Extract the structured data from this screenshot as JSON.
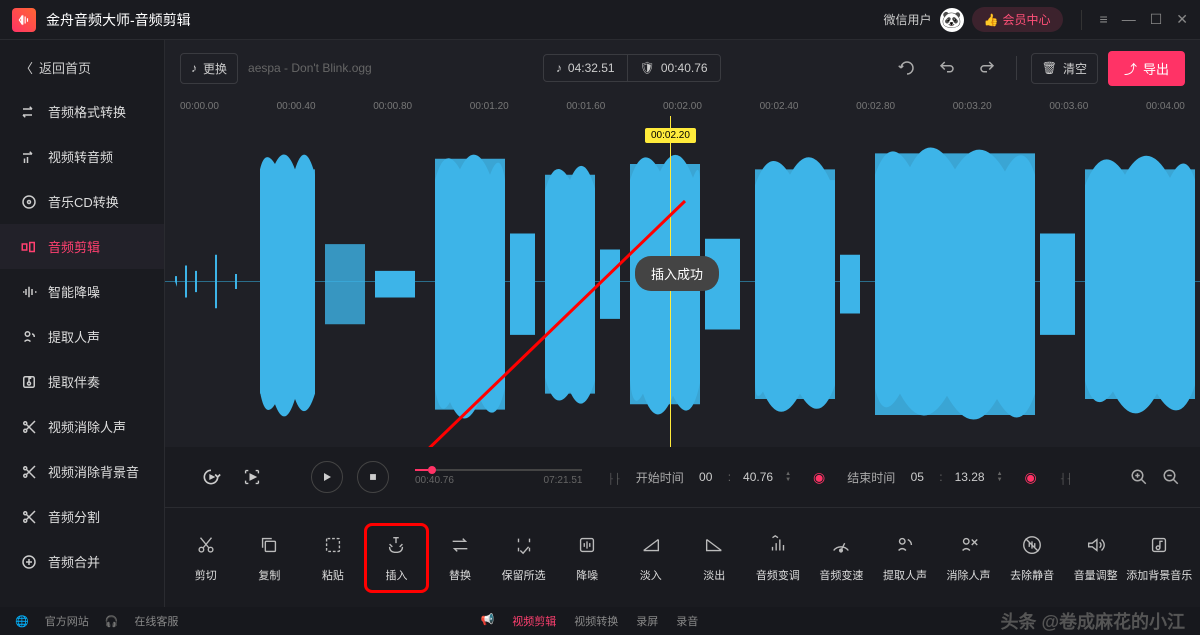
{
  "header": {
    "title": "金舟音频大师-音频剪辑",
    "user_label": "微信用户",
    "vip_label": "会员中心"
  },
  "sidebar": {
    "back": "返回首页",
    "items": [
      {
        "label": "音频格式转换"
      },
      {
        "label": "视频转音频"
      },
      {
        "label": "音乐CD转换"
      },
      {
        "label": "音频剪辑"
      },
      {
        "label": "智能降噪"
      },
      {
        "label": "提取人声"
      },
      {
        "label": "提取伴奏"
      },
      {
        "label": "视频消除人声"
      },
      {
        "label": "视频消除背景音"
      },
      {
        "label": "音频分割"
      },
      {
        "label": "音频合并"
      }
    ],
    "active_index": 3
  },
  "toolbar": {
    "replace_label": "更换",
    "filename": "aespa - Don't Blink.ogg",
    "total_time": "04:32.51",
    "selection_time": "00:40.76",
    "clear_label": "清空",
    "export_label": "导出"
  },
  "ruler": {
    "marks": [
      "00:00.00",
      "00:00.40",
      "00:00.80",
      "00:01.20",
      "00:01.60",
      "00:02.00",
      "00:02.40",
      "00:02.80",
      "00:03.20",
      "00:03.60",
      "00:04.00"
    ]
  },
  "playhead": {
    "label": "00:02.20"
  },
  "toast": {
    "text": "插入成功"
  },
  "playback": {
    "current": "00:40.76",
    "total": "07:21.51",
    "start_label": "开始时间",
    "start_mm": "00",
    "start_ss": "40.76",
    "end_label": "结束时间",
    "end_mm": "05",
    "end_ss": "13.28"
  },
  "tools": [
    {
      "label": "剪切"
    },
    {
      "label": "复制"
    },
    {
      "label": "粘贴"
    },
    {
      "label": "插入"
    },
    {
      "label": "替换"
    },
    {
      "label": "保留所选"
    },
    {
      "label": "降噪"
    },
    {
      "label": "淡入"
    },
    {
      "label": "淡出"
    },
    {
      "label": "音频变调"
    },
    {
      "label": "音频变速"
    },
    {
      "label": "提取人声"
    },
    {
      "label": "消除人声"
    },
    {
      "label": "去除静音"
    },
    {
      "label": "音量调整"
    },
    {
      "label": "添加背景音乐"
    }
  ],
  "highlighted_tool_index": 3,
  "footer": {
    "official_site": "官方网站",
    "online_service": "在线客服",
    "tabs": [
      "视频剪辑",
      "视频转换",
      "录屏",
      "录音"
    ],
    "active_tab": 0,
    "watermark": "头条 @卷成麻花的小江"
  }
}
